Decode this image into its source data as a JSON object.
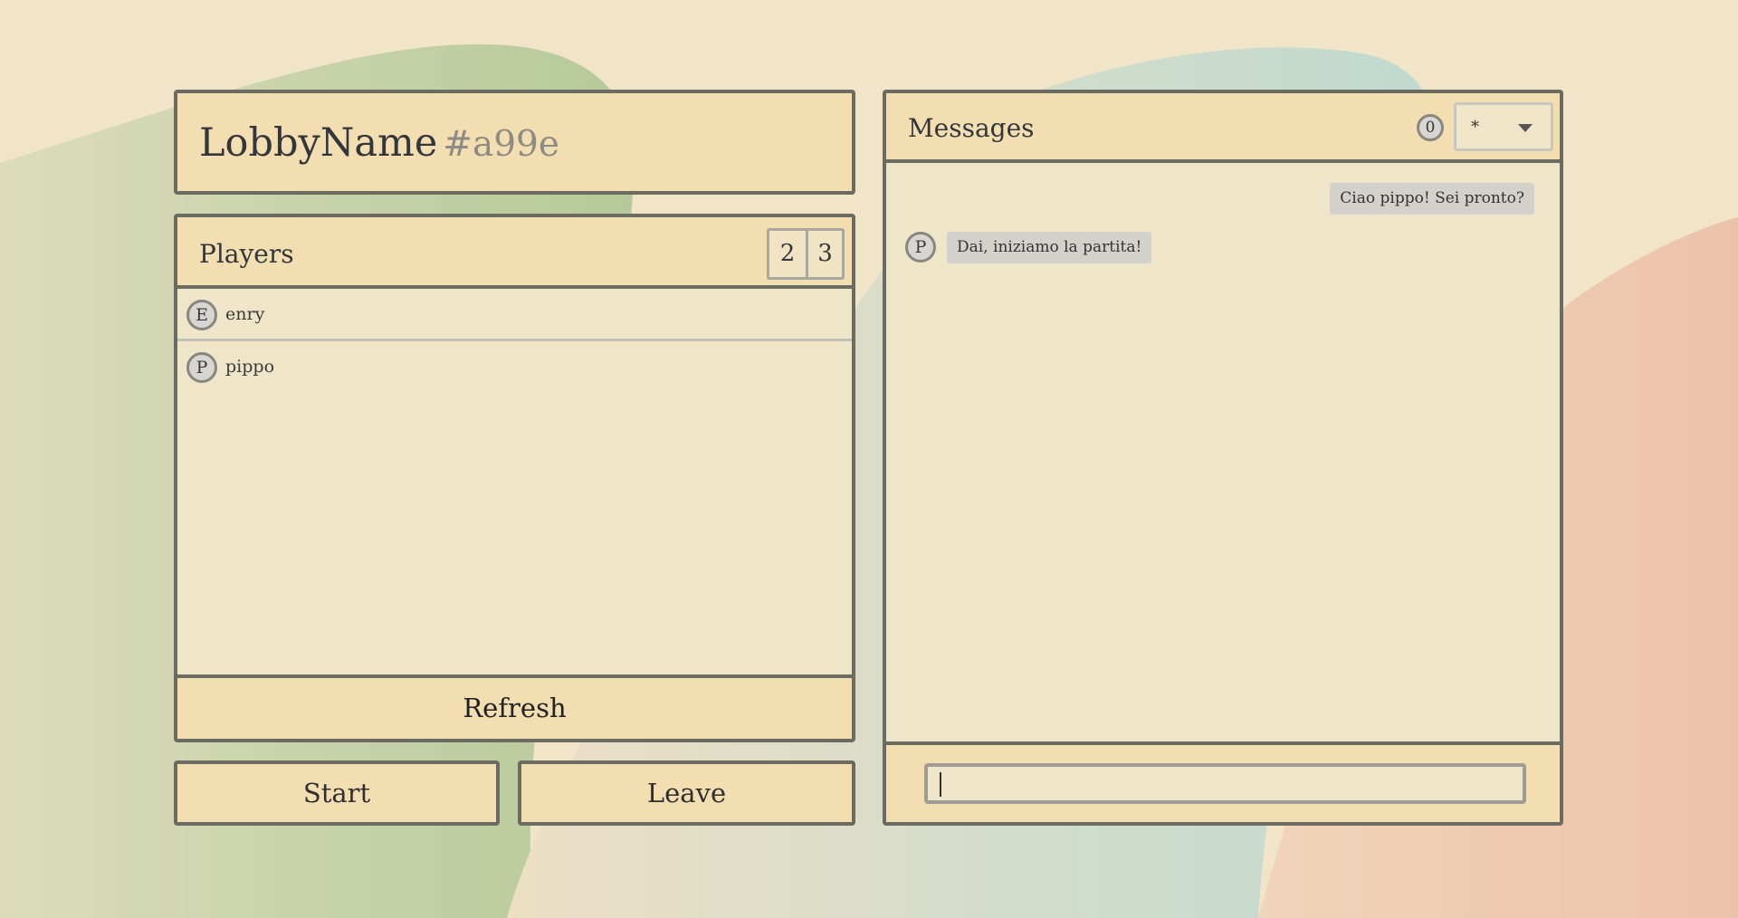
{
  "lobby": {
    "name": "LobbyName",
    "id": "#a99e"
  },
  "players": {
    "title": "Players",
    "count": "2",
    "max": "3",
    "items": [
      {
        "initial": "E",
        "name": "enry"
      },
      {
        "initial": "P",
        "name": "pippo"
      }
    ],
    "refresh_label": "Refresh"
  },
  "actions": {
    "start_label": "Start",
    "leave_label": "Leave"
  },
  "messages": {
    "title": "Messages",
    "unread": "0",
    "channel": "*",
    "items": [
      {
        "direction": "out",
        "text": "Ciao pippo! Sei pronto?"
      },
      {
        "direction": "in",
        "initial": "P",
        "text": "Dai, iniziamo la partita!"
      }
    ],
    "input_value": ""
  },
  "colors": {
    "panel_header": "#f3deb2",
    "panel_body": "#efe5c9",
    "border": "#6b6b61",
    "background": "#f1e4c9"
  }
}
